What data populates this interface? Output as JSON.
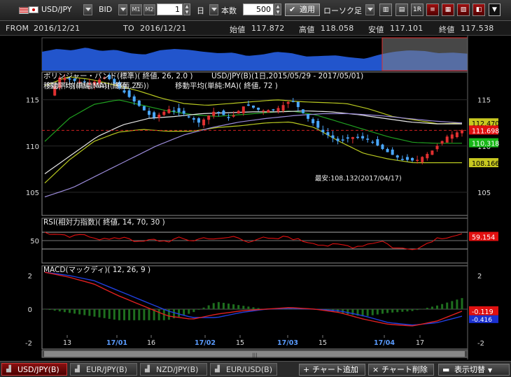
{
  "toolbar": {
    "symbol": "USD/JPY",
    "price_type": "BID",
    "m1": "M1",
    "m2": "M2",
    "period_value": "1",
    "period_unit": "日",
    "count_label": "本数",
    "count_value": "500",
    "apply_label": "適用",
    "candle_label": "ローソク足"
  },
  "infobar": {
    "from_label": "FROM",
    "from_date": "2016/12/21",
    "to_label": "TO",
    "to_date": "2016/12/21",
    "open_label": "始値",
    "open_value": "117.872",
    "high_label": "高値",
    "high_value": "118.058",
    "low_label": "安値",
    "low_value": "117.101",
    "close_label": "終値",
    "close_value": "117.538"
  },
  "main_chart": {
    "bb_label": "ボリンジャー・バンド(標準)( 終値, 26, 2.0 )",
    "title": "USD/JPY(B)(1日,2015/05/29 - 2017/05/01)",
    "ma_label_1": "移動平均(単純:MA)( 終値, 25 )",
    "ma_label_overlap": "移動平均(単純:MA)( 終値, 75 )",
    "ma_label_2": "移動平均(単純:MA)( 終値, 72 )",
    "low_annotation": "最安:108.132(2017/04/17)",
    "y_ticks": [
      "115",
      "110",
      "105"
    ],
    "badges": [
      {
        "value": "112.470",
        "color": "#c8c820",
        "text_color": "#000"
      },
      {
        "value": "111.698",
        "color": "#e01010",
        "text_color": "#fff"
      },
      {
        "value": "110.318",
        "color": "#18b818",
        "text_color": "#fff"
      },
      {
        "value": "108.166",
        "color": "#c8c820",
        "text_color": "#000"
      }
    ]
  },
  "rsi": {
    "label": "RSI(相対力指数)( 終値, 14, 70, 30 )",
    "y_tick": "50",
    "badge_value": "59.154",
    "badge_color": "#e01010"
  },
  "macd": {
    "label": "MACD(マックディ)( 12, 26, 9 )",
    "y_ticks": [
      "2",
      "0",
      "-2"
    ],
    "badge_red": "-0.119",
    "badge_blue": "-0.416"
  },
  "x_axis": {
    "ticks": [
      "13",
      "17/01",
      "16",
      "17/02",
      "15",
      "17/03",
      "15",
      "17/04",
      "17"
    ]
  },
  "tabs": [
    {
      "label": "USD/JPY(B)",
      "active": true
    },
    {
      "label": "EUR/JPY(B)",
      "active": false
    },
    {
      "label": "NZD/JPY(B)",
      "active": false
    },
    {
      "label": "EUR/USD(B)",
      "active": false
    }
  ],
  "actions": {
    "add_chart": "チャート追加",
    "delete_chart": "チャート削除",
    "switch_view": "表示切替"
  },
  "colors": {
    "bull": "#e03030",
    "bear": "#4aa8ff",
    "bb_outer": "#b8c820",
    "bb_mid": "#20a020",
    "ma_white": "#e8e8e8",
    "ma_violet": "#9a8ad8",
    "rsi_line": "#e01010",
    "macd_red": "#e02020",
    "macd_blue": "#2040e0",
    "hist": "#1e6e1e"
  }
}
